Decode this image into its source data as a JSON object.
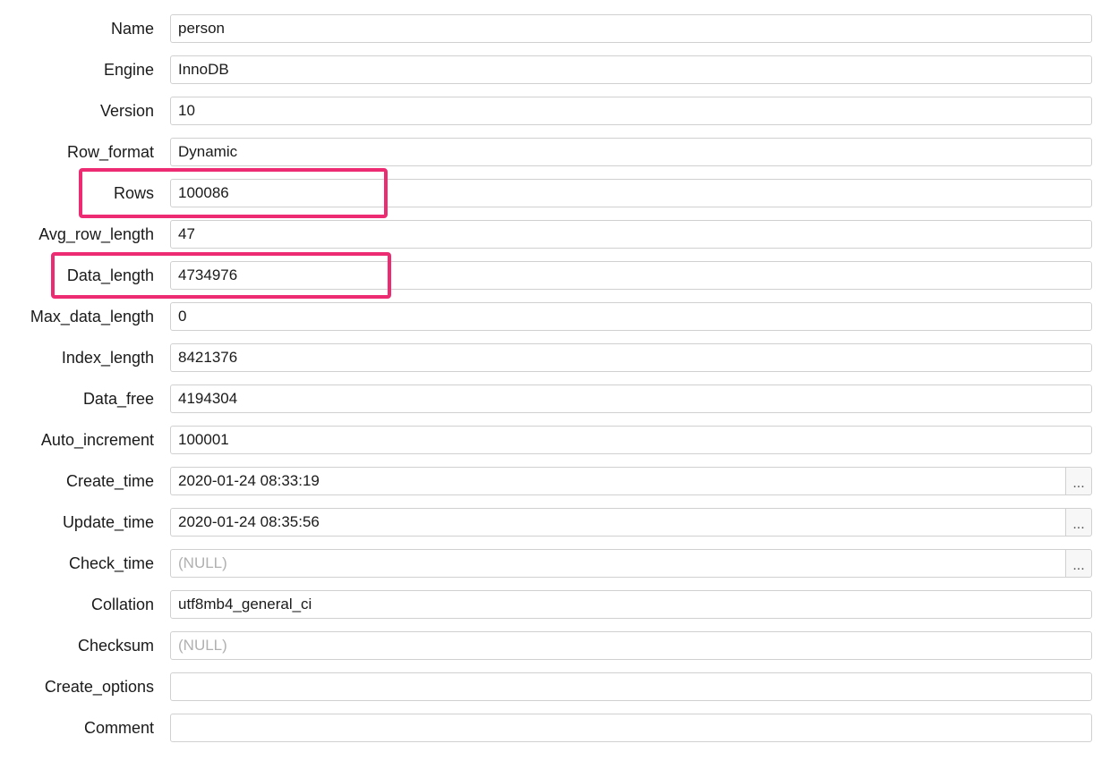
{
  "labels": {
    "name": "Name",
    "engine": "Engine",
    "version": "Version",
    "row_format": "Row_format",
    "rows": "Rows",
    "avg_row_length": "Avg_row_length",
    "data_length": "Data_length",
    "max_data_length": "Max_data_length",
    "index_length": "Index_length",
    "data_free": "Data_free",
    "auto_increment": "Auto_increment",
    "create_time": "Create_time",
    "update_time": "Update_time",
    "check_time": "Check_time",
    "collation": "Collation",
    "checksum": "Checksum",
    "create_options": "Create_options",
    "comment": "Comment"
  },
  "values": {
    "name": "person",
    "engine": "InnoDB",
    "version": "10",
    "row_format": "Dynamic",
    "rows": "100086",
    "avg_row_length": "47",
    "data_length": "4734976",
    "max_data_length": "0",
    "index_length": "8421376",
    "data_free": "4194304",
    "auto_increment": "100001",
    "create_time": "2020-01-24 08:33:19",
    "update_time": "2020-01-24 08:35:56",
    "check_time": "(NULL)",
    "collation": "utf8mb4_general_ci",
    "checksum": "(NULL)",
    "create_options": "",
    "comment": ""
  },
  "buttons": {
    "ellipsis": "..."
  }
}
